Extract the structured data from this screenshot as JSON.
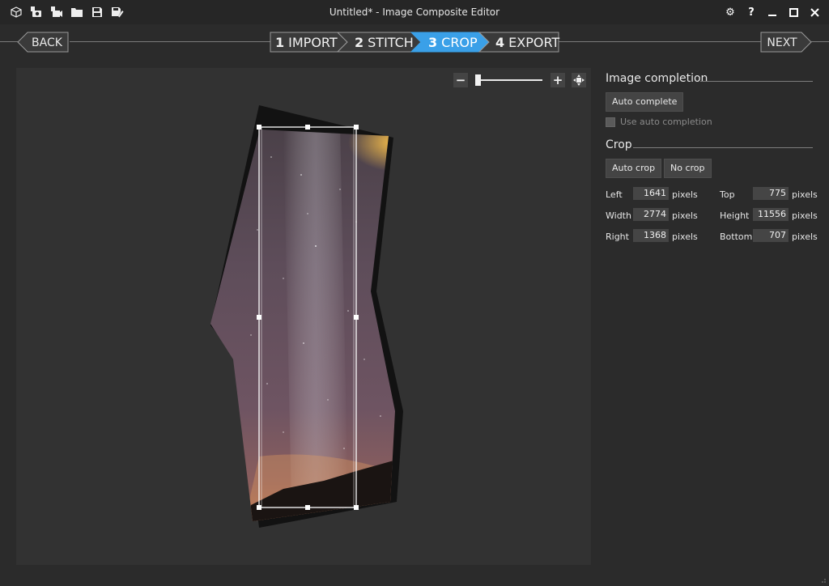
{
  "app": {
    "title": "Untitled* - Image Composite Editor"
  },
  "toolbar": {
    "icons": [
      "new-project-icon",
      "new-panorama-icon",
      "new-video-panorama-icon",
      "open-folder-icon",
      "save-icon",
      "save-as-icon"
    ]
  },
  "window_controls": {
    "settings_glyph": "⚙",
    "help_glyph": "?",
    "minimize_glyph": "—",
    "maximize_glyph": "□",
    "close_glyph": "✕"
  },
  "nav": {
    "back_label": "BACK",
    "next_label": "NEXT",
    "steps": [
      {
        "num": "1",
        "label": "IMPORT",
        "active": false
      },
      {
        "num": "2",
        "label": "STITCH",
        "active": false
      },
      {
        "num": "3",
        "label": "CROP",
        "active": true
      },
      {
        "num": "4",
        "label": "EXPORT",
        "active": false
      }
    ]
  },
  "zoom": {
    "minus": "−",
    "plus": "+",
    "level": 0.03
  },
  "image_completion": {
    "title": "Image completion",
    "auto_complete_label": "Auto complete",
    "use_auto_completion_label": "Use auto completion",
    "use_auto_completion_checked": false
  },
  "crop": {
    "title": "Crop",
    "auto_crop_label": "Auto crop",
    "no_crop_label": "No crop",
    "fields": {
      "left": {
        "label": "Left",
        "value": "1641",
        "unit": "pixels"
      },
      "top": {
        "label": "Top",
        "value": "775",
        "unit": "pixels"
      },
      "width": {
        "label": "Width",
        "value": "2774",
        "unit": "pixels"
      },
      "height": {
        "label": "Height",
        "value": "11556",
        "unit": "pixels"
      },
      "right": {
        "label": "Right",
        "value": "1368",
        "unit": "pixels"
      },
      "bottom": {
        "label": "Bottom",
        "value": "707",
        "unit": "pixels"
      }
    }
  },
  "colors": {
    "accent": "#3aa0e8",
    "background": "#2b2b2b",
    "canvas": "#323232"
  }
}
